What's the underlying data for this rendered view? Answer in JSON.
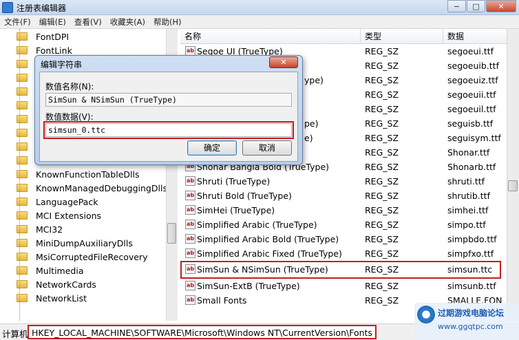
{
  "window": {
    "title": "注册表编辑器",
    "buttons": {
      "minimize": "−",
      "maximize": "□",
      "close": "✕"
    }
  },
  "menu": [
    "文件(F)",
    "编辑(E)",
    "查看(V)",
    "收藏夹(A)",
    "帮助(H)"
  ],
  "tree": {
    "items": [
      "FontDPI",
      "FontLink",
      "",
      "",
      "",
      "",
      "",
      "",
      "",
      "",
      "KnownFunctionTableDlls",
      "KnownManagedDebuggingDlls",
      "LanguagePack",
      "MCI Extensions",
      "MCI32",
      "MiniDumpAuxiliaryDlls",
      "MsiCorruptedFileRecovery",
      "Multimedia",
      "NetworkCards",
      "NetworkList"
    ]
  },
  "list": {
    "columns": {
      "name": "名称",
      "type": "类型",
      "data": "数据"
    },
    "rows": [
      {
        "name": "Segoe UI (TrueType)",
        "type": "REG_SZ",
        "data": "segoeui.ttf"
      },
      {
        "name": "",
        "type": "REG_SZ",
        "data": "segoeuib.ttf"
      },
      {
        "name": "ype)",
        "type": "REG_SZ",
        "data": "segoeuiz.ttf"
      },
      {
        "name": "",
        "type": "REG_SZ",
        "data": "segoeuii.ttf"
      },
      {
        "name": "",
        "type": "REG_SZ",
        "data": "segoeuil.ttf"
      },
      {
        "name": "pe)",
        "type": "REG_SZ",
        "data": "seguisb.ttf"
      },
      {
        "name": "e)",
        "type": "REG_SZ",
        "data": "seguisym.ttf"
      },
      {
        "name": "",
        "type": "REG_SZ",
        "data": "Shonar.ttf"
      },
      {
        "name": "Shonar Bangla Bold (TrueType)",
        "type": "REG_SZ",
        "data": "Shonarb.ttf"
      },
      {
        "name": "Shruti (TrueType)",
        "type": "REG_SZ",
        "data": "shruti.ttf"
      },
      {
        "name": "Shruti Bold (TrueType)",
        "type": "REG_SZ",
        "data": "shrutib.ttf"
      },
      {
        "name": "SimHei (TrueType)",
        "type": "REG_SZ",
        "data": "simhei.ttf"
      },
      {
        "name": "Simplified Arabic (TrueType)",
        "type": "REG_SZ",
        "data": "simpo.ttf"
      },
      {
        "name": "Simplified Arabic Bold (TrueType)",
        "type": "REG_SZ",
        "data": "simpbdo.ttf"
      },
      {
        "name": "Simplified Arabic Fixed (TrueType)",
        "type": "REG_SZ",
        "data": "simpfxo.ttf"
      },
      {
        "name": "SimSun & NSimSun (TrueType)",
        "type": "REG_SZ",
        "data": "simsun.ttc"
      },
      {
        "name": "SimSun-ExtB (TrueType)",
        "type": "REG_SZ",
        "data": "simsunb.ttf"
      },
      {
        "name": "Small Fonts",
        "type": "REG_SZ",
        "data": "SMALLE.FON"
      }
    ]
  },
  "dialog": {
    "title": "编辑字符串",
    "close": "✕",
    "name_label": "数值名称(N):",
    "name_value": "SimSun & NSimSun (TrueType)",
    "data_label": "数值数据(V):",
    "data_value": "simsun_0.ttc",
    "ok": "确定",
    "cancel": "取消"
  },
  "status": {
    "label": "计算机",
    "path": "HKEY_LOCAL_MACHINE\\SOFTWARE\\Microsoft\\Windows NT\\CurrentVersion\\Fonts"
  },
  "watermark": {
    "line1": "过期游戏电脑论坛",
    "line2": "www.ggqtpc.com"
  }
}
